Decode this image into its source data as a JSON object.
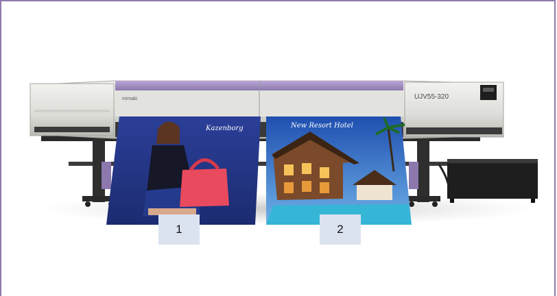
{
  "image": {
    "subject": "wide-format-printer-icon",
    "printer_model": "UJV55-320",
    "brand_mark": "mimaki"
  },
  "prints": [
    {
      "label": "1",
      "caption": "Kazenborg"
    },
    {
      "label": "2",
      "caption": "New Resort Hotel"
    }
  ],
  "colors": {
    "frame": "#8e7aa8",
    "printer_body": "#e6e6e2",
    "printer_accent": "#a38fc0",
    "label_bg": "#dbe3f1"
  }
}
